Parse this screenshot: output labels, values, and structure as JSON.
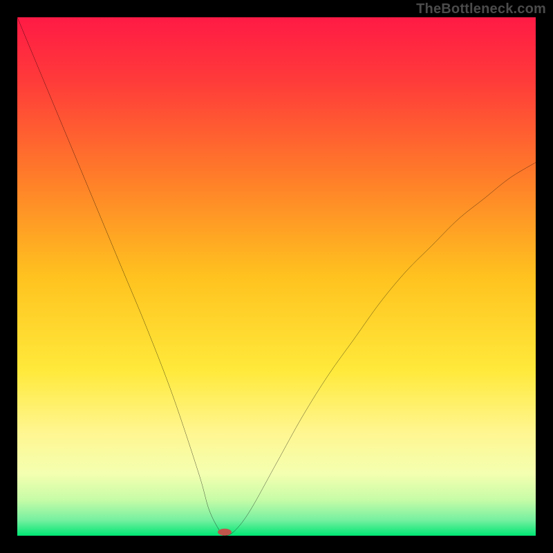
{
  "watermark": "TheBottleneck.com",
  "chart_data": {
    "type": "line",
    "title": "",
    "xlabel": "",
    "ylabel": "",
    "xlim": [
      0,
      100
    ],
    "ylim": [
      0,
      100
    ],
    "grid": false,
    "legend": false,
    "background_gradient": [
      "#ff1a45",
      "#ff9a2a",
      "#ffd61f",
      "#fff690",
      "#c8fca7",
      "#00e674"
    ],
    "series": [
      {
        "name": "bottleneck-curve",
        "color": "#000000",
        "x": [
          0,
          5,
          10,
          15,
          20,
          25,
          30,
          35,
          37,
          39,
          40,
          42,
          45,
          50,
          55,
          60,
          65,
          70,
          75,
          80,
          85,
          90,
          95,
          100
        ],
        "y": [
          100,
          88,
          76,
          64,
          52,
          40,
          27,
          12,
          5,
          1,
          0,
          1,
          5,
          14,
          23,
          31,
          38,
          45,
          51,
          56,
          61,
          65,
          69,
          72
        ]
      }
    ],
    "marker": {
      "name": "optimal-point",
      "x": 40,
      "y": 0.7,
      "color": "#c1554c",
      "rx": 10,
      "ry": 5
    }
  }
}
